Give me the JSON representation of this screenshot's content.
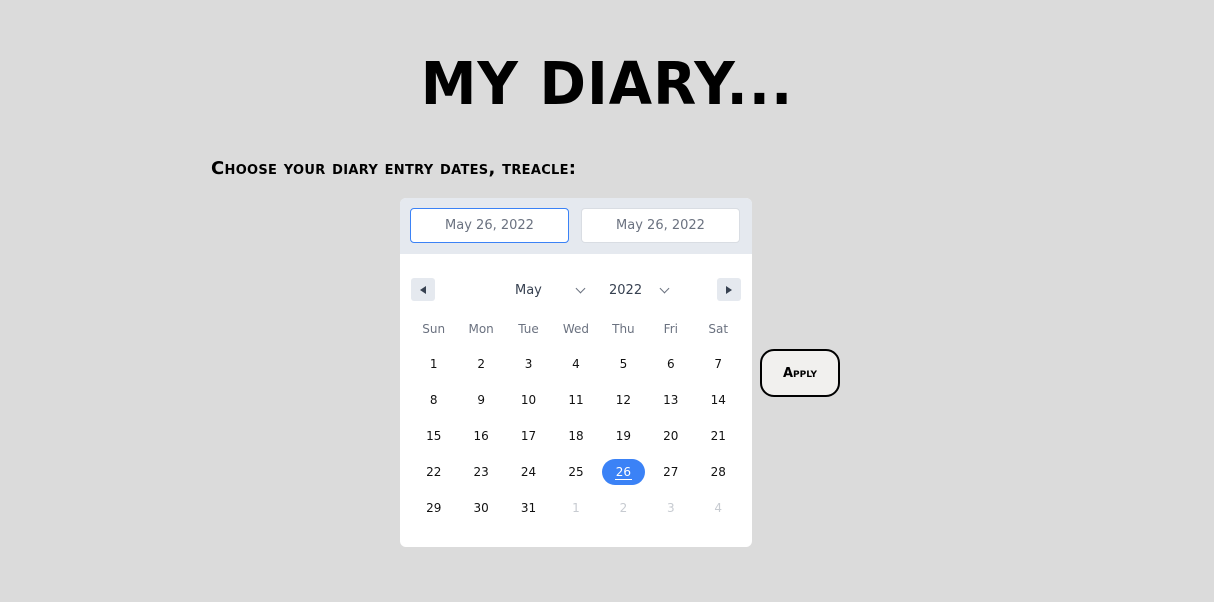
{
  "header": {
    "title": "MY DIARY..."
  },
  "prompt": "Choose your diary entry dates, treacle:",
  "picker": {
    "start_date": "May 26, 2022",
    "end_date": "May 26, 2022",
    "month": "May",
    "year": "2022",
    "weekdays": [
      "Sun",
      "Mon",
      "Tue",
      "Wed",
      "Thu",
      "Fri",
      "Sat"
    ],
    "weeks": [
      [
        {
          "d": "1"
        },
        {
          "d": "2"
        },
        {
          "d": "3"
        },
        {
          "d": "4"
        },
        {
          "d": "5"
        },
        {
          "d": "6"
        },
        {
          "d": "7"
        }
      ],
      [
        {
          "d": "8"
        },
        {
          "d": "9"
        },
        {
          "d": "10"
        },
        {
          "d": "11"
        },
        {
          "d": "12"
        },
        {
          "d": "13"
        },
        {
          "d": "14"
        }
      ],
      [
        {
          "d": "15"
        },
        {
          "d": "16"
        },
        {
          "d": "17"
        },
        {
          "d": "18"
        },
        {
          "d": "19"
        },
        {
          "d": "20"
        },
        {
          "d": "21"
        }
      ],
      [
        {
          "d": "22"
        },
        {
          "d": "23"
        },
        {
          "d": "24"
        },
        {
          "d": "25"
        },
        {
          "d": "26",
          "selected": true
        },
        {
          "d": "27"
        },
        {
          "d": "28"
        }
      ],
      [
        {
          "d": "29"
        },
        {
          "d": "30"
        },
        {
          "d": "31"
        },
        {
          "d": "1",
          "muted": true
        },
        {
          "d": "2",
          "muted": true
        },
        {
          "d": "3",
          "muted": true
        },
        {
          "d": "4",
          "muted": true
        }
      ]
    ],
    "accent_color": "#3b82f6"
  },
  "apply_label": "Apply",
  "icons": {
    "prev": "caret-left-icon",
    "next": "caret-right-icon",
    "dropdown": "chevron-down-icon"
  }
}
